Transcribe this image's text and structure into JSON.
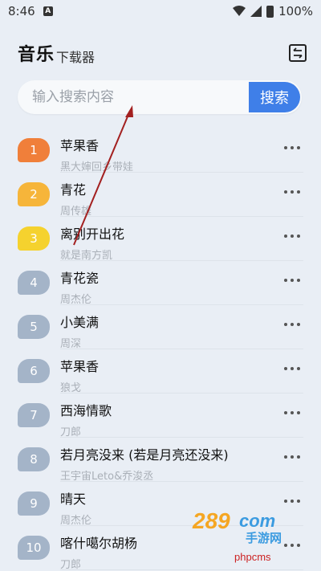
{
  "status_bar": {
    "time": "8:46",
    "notification_letter": "A",
    "battery": "100%"
  },
  "header": {
    "title": "音乐",
    "subtitle": "下载器"
  },
  "search": {
    "placeholder": "输入搜索内容",
    "button_label": "搜索"
  },
  "songs": [
    {
      "rank": "1",
      "title": "苹果香",
      "artist": "黑大婶回乡带娃",
      "color": "#f07f3a"
    },
    {
      "rank": "2",
      "title": "青花",
      "artist": "周传雄",
      "color": "#f6b53a"
    },
    {
      "rank": "3",
      "title": "离别开出花",
      "artist": "就是南方凯",
      "color": "#f5d22e"
    },
    {
      "rank": "4",
      "title": "青花瓷",
      "artist": "周杰伦",
      "color": "#a4b4c8"
    },
    {
      "rank": "5",
      "title": "小美满",
      "artist": "周深",
      "color": "#a4b4c8"
    },
    {
      "rank": "6",
      "title": "苹果香",
      "artist": "狼戈",
      "color": "#a4b4c8"
    },
    {
      "rank": "7",
      "title": "西海情歌",
      "artist": "刀郎",
      "color": "#a4b4c8"
    },
    {
      "rank": "8",
      "title": "若月亮没来 (若是月亮还没来)",
      "artist": "王宇宙Leto&乔浚丞",
      "color": "#a4b4c8"
    },
    {
      "rank": "9",
      "title": "晴天",
      "artist": "周杰伦",
      "color": "#a4b4c8"
    },
    {
      "rank": "10",
      "title": "喀什噶尔胡杨",
      "artist": "刀郎",
      "color": "#a4b4c8"
    }
  ],
  "watermark": {
    "logo_text": "289.com 手游网",
    "site_text": "phpcms"
  },
  "colors": {
    "background": "#e9eef5",
    "accent": "#3f7fe8",
    "arrow": "#a32020"
  }
}
